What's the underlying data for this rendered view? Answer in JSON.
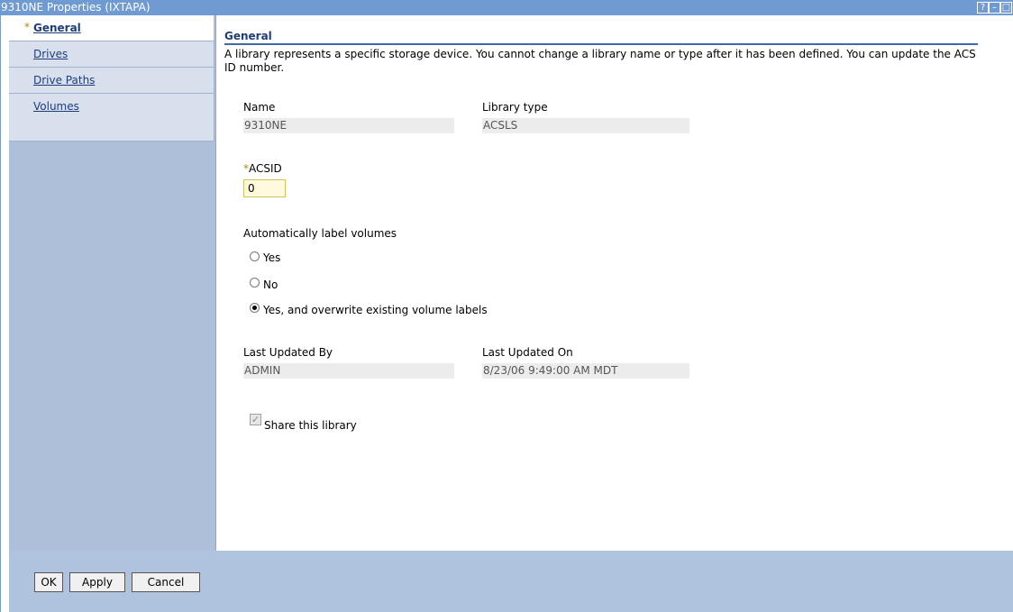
{
  "window": {
    "title": "9310NE Properties (IXTAPA)",
    "controls": [
      "?",
      "–",
      "□"
    ]
  },
  "nav": {
    "items": [
      {
        "label": "General",
        "selected": true,
        "required": true
      },
      {
        "label": "Drives",
        "selected": false
      },
      {
        "label": "Drive Paths",
        "selected": false
      },
      {
        "label": "Volumes",
        "selected": false
      }
    ],
    "required_marker": "*"
  },
  "section": {
    "title": "General",
    "description": "A library represents a specific storage device. You cannot change a library name or type after it has been defined. You can update the ACS ID number."
  },
  "fields": {
    "name_label": "Name",
    "name_value": "9310NE",
    "library_type_label": "Library type",
    "library_type_value": "ACSLS",
    "acsid_required_marker": "*",
    "acsid_label": "ACSID",
    "acsid_value": "0",
    "auto_label_title": "Automatically label volumes",
    "auto_label_options": [
      {
        "label": "Yes",
        "selected": false
      },
      {
        "label": "No",
        "selected": false
      },
      {
        "label": "Yes, and overwrite existing volume labels",
        "selected": true
      }
    ],
    "last_updated_by_label": "Last Updated By",
    "last_updated_by_value": "ADMIN",
    "last_updated_on_label": "Last Updated On",
    "last_updated_on_value": "8/23/06 9:49:00 AM MDT",
    "share_label": "Share this library",
    "share_checked": true
  },
  "buttons": {
    "ok": "OK",
    "apply": "Apply",
    "cancel": "Cancel"
  }
}
